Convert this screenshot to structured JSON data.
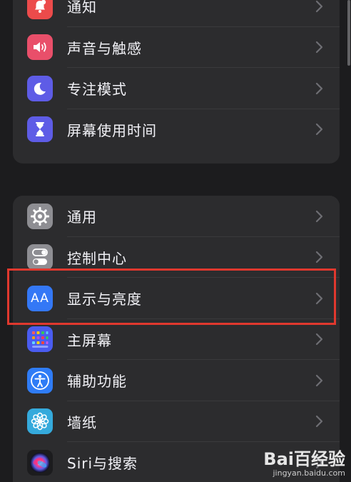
{
  "groups": [
    {
      "items": [
        {
          "label": "通知",
          "icon": "bell-icon",
          "color": "#ec4b4b"
        },
        {
          "label": "声音与触感",
          "icon": "speaker-icon",
          "color": "#e94f6a"
        },
        {
          "label": "专注模式",
          "icon": "moon-icon",
          "color": "#5e5ce6"
        },
        {
          "label": "屏幕使用时间",
          "icon": "hourglass-icon",
          "color": "#5e5ce6"
        }
      ]
    },
    {
      "items": [
        {
          "label": "通用",
          "icon": "gear-icon",
          "color": "#8e8e93"
        },
        {
          "label": "控制中心",
          "icon": "toggle-icon",
          "color": "#8e8e93"
        },
        {
          "label": "显示与亮度",
          "icon": "text-size-icon",
          "color": "#3478f6"
        },
        {
          "label": "主屏幕",
          "icon": "home-grid-icon",
          "color": "#4a5cf0"
        },
        {
          "label": "辅助功能",
          "icon": "accessibility-icon",
          "color": "#2f7cf6"
        },
        {
          "label": "墙纸",
          "icon": "flower-icon",
          "color": "#35aadc"
        },
        {
          "label": "Siri与搜索",
          "icon": "siri-icon",
          "color": "#1c1c1e"
        }
      ]
    }
  ],
  "icon_text": {
    "display": "AA"
  },
  "highlight_color": "#e0382e",
  "watermark": {
    "logo": "Bai百经验",
    "sub": "jingyan.baidu.com"
  }
}
